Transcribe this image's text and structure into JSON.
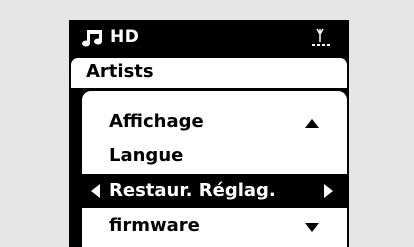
{
  "status": {
    "source": "HD",
    "source_icon": "music-note-icon",
    "signal_icon": "antenna-signal-icon"
  },
  "header": {
    "title": "Artists"
  },
  "menu": {
    "items": [
      {
        "label": "Affichage",
        "selected": false,
        "indicator": "scroll-up"
      },
      {
        "label": "Langue",
        "selected": false
      },
      {
        "label": "Restaur. Réglag.",
        "selected": true
      },
      {
        "label": "firmware",
        "selected": false,
        "indicator": "scroll-down"
      }
    ]
  },
  "colors": {
    "background": "#e6e6e6",
    "screen": "#000000",
    "panel": "#ffffff",
    "highlight": "#000000",
    "highlight_text": "#ffffff"
  }
}
